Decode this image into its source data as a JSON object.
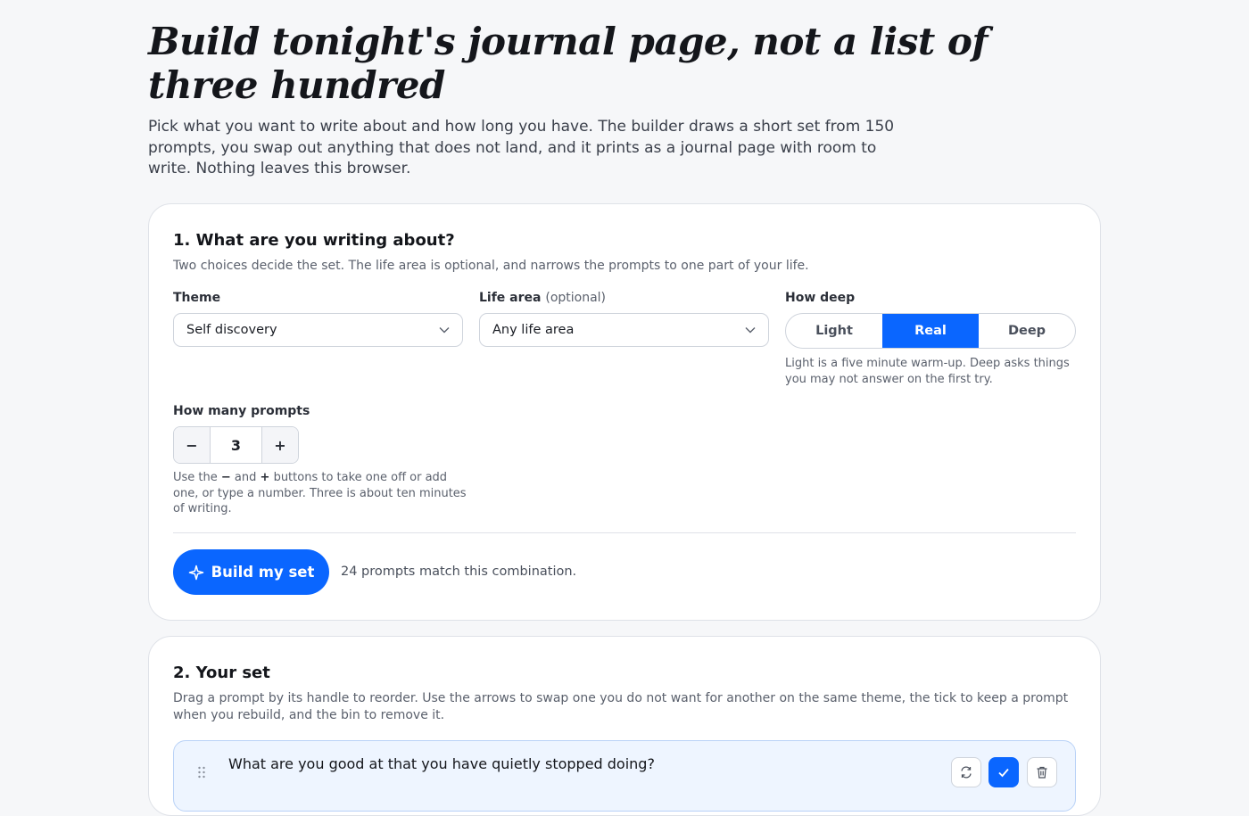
{
  "hero": {
    "title": "Build tonight's journal page, not a list of three hundred",
    "lede": "Pick what you want to write about and how long you have. The builder draws a short set from 150 prompts, you swap out anything that does not land, and it prints as a journal page with room to write. Nothing leaves this browser."
  },
  "step1": {
    "heading": "1. What are you writing about?",
    "sub": "Two choices decide the set. The life area is optional, and narrows the prompts to one part of your life.",
    "theme": {
      "label": "Theme",
      "value": "Self discovery"
    },
    "life_area": {
      "label": "Life area",
      "optional": "(optional)",
      "value": "Any life area"
    },
    "depth": {
      "label": "How deep",
      "options": [
        "Light",
        "Real",
        "Deep"
      ],
      "selected": "Real",
      "hint": "Light is a five minute warm-up. Deep asks things you may not answer on the first try."
    },
    "count": {
      "label": "How many prompts",
      "value": "3",
      "minus": "−",
      "plus": "+",
      "hint_pre": "Use the ",
      "hint_minus": "−",
      "hint_mid": " and ",
      "hint_plus": "+",
      "hint_post": " buttons to take one off or add one, or type a number. Three is about ten minutes of writing."
    },
    "build_label": "Build my set",
    "match_text": "24 prompts match this combination."
  },
  "step2": {
    "heading": "2. Your set",
    "sub": "Drag a prompt by its handle to reorder. Use the arrows to swap one you do not want for another on the same theme, the tick to keep a prompt when you rebuild, and the bin to remove it.",
    "prompts": [
      {
        "text": "What are you good at that you have quietly stopped doing?",
        "kept": true
      }
    ]
  },
  "colors": {
    "accent": "#0a66ff",
    "page_bg": "#f6f7f9",
    "kept_row_bg": "#eef5ff"
  }
}
